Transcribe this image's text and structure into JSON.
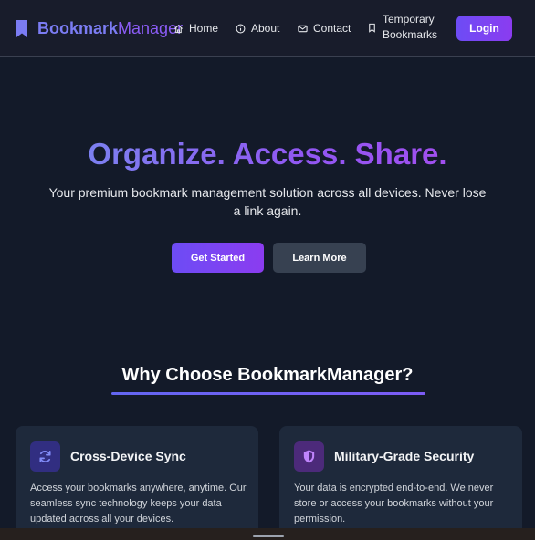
{
  "nav": {
    "brand_bold": "Bookmark",
    "brand_light": "Manager",
    "links": [
      {
        "label": "Home",
        "icon": "home-icon"
      },
      {
        "label": "About",
        "icon": "info-icon"
      },
      {
        "label": "Contact",
        "icon": "envelope-icon"
      },
      {
        "label": "Temporary Bookmarks",
        "icon": "bookmark-icon"
      }
    ],
    "login_label": "Login"
  },
  "hero": {
    "title": "Organize. Access. Share.",
    "subtitle": "Your premium bookmark management solution across all devices. Never lose a link again.",
    "primary_cta": "Get Started",
    "secondary_cta": "Learn More"
  },
  "features": {
    "heading": "Why Choose BookmarkManager?",
    "cards": [
      {
        "title": "Cross-Device Sync",
        "icon": "sync-icon",
        "text": "Access your bookmarks anywhere, anytime. Our seamless sync technology keeps your data updated across all your devices."
      },
      {
        "title": "Military-Grade Security",
        "icon": "shield-icon",
        "text": "Your data is encrypted end-to-end. We never store or access your bookmarks without your permission."
      }
    ]
  },
  "colors": {
    "background": "#131a29",
    "accent": "#6d4cf5",
    "card": "#1e293b"
  }
}
